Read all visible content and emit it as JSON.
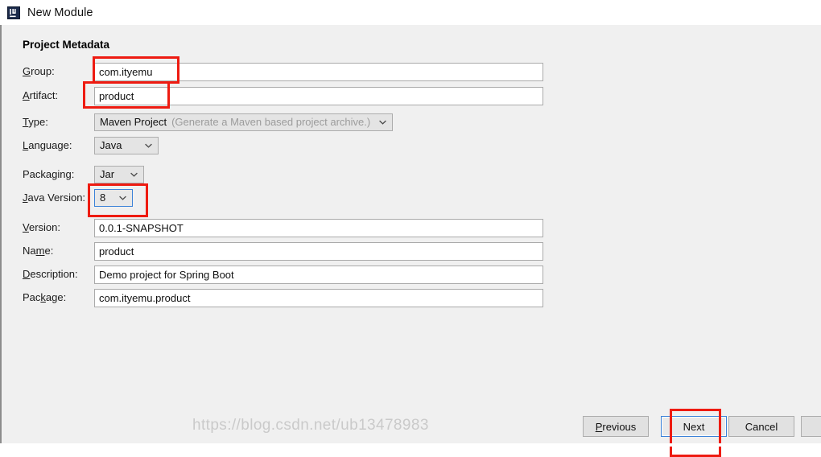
{
  "window": {
    "title": "New Module",
    "app_icon": "intellij-idea-icon",
    "accent_focus_color": "#3c82d8",
    "annotation_color": "#ee1b11",
    "background_color": "#f0f0f0"
  },
  "form": {
    "section_title": "Project Metadata",
    "fields": [
      {
        "id": "group",
        "label_pre": "",
        "label_mnemonic": "G",
        "label_post": "roup:",
        "kind": "text",
        "value": "com.ityemu",
        "annotated": true
      },
      {
        "id": "artifact",
        "label_pre": "",
        "label_mnemonic": "A",
        "label_post": "rtifact:",
        "kind": "text",
        "value": "product",
        "annotated": true
      },
      {
        "id": "type",
        "label_pre": "",
        "label_mnemonic": "T",
        "label_post": "ype:",
        "kind": "combo",
        "value": "Maven Project",
        "hint": "(Generate a Maven based project archive.)",
        "annotated": false
      },
      {
        "id": "language",
        "label_pre": "",
        "label_mnemonic": "L",
        "label_post": "anguage:",
        "kind": "combo",
        "value": "Java",
        "hint": "",
        "annotated": false
      },
      {
        "id": "packaging",
        "label_pre": "Packa",
        "label_mnemonic": "g",
        "label_post": "ing:",
        "kind": "combo",
        "value": "Jar",
        "hint": "",
        "annotated": false
      },
      {
        "id": "java-version",
        "label_pre": "",
        "label_mnemonic": "J",
        "label_post": "ava Version:",
        "kind": "combo",
        "value": "8",
        "hint": "",
        "annotated": true,
        "focused": true
      },
      {
        "id": "version",
        "label_pre": "",
        "label_mnemonic": "V",
        "label_post": "ersion:",
        "kind": "text",
        "value": "0.0.1-SNAPSHOT",
        "annotated": false
      },
      {
        "id": "name",
        "label_pre": "Na",
        "label_mnemonic": "m",
        "label_post": "e:",
        "kind": "text",
        "value": "product",
        "annotated": false
      },
      {
        "id": "description",
        "label_pre": "",
        "label_mnemonic": "D",
        "label_post": "escription:",
        "kind": "text",
        "value": "Demo project for Spring Boot",
        "annotated": false
      },
      {
        "id": "package",
        "label_pre": "Pac",
        "label_mnemonic": "k",
        "label_post": "age:",
        "kind": "text",
        "value": "com.ityemu.product",
        "annotated": false
      }
    ]
  },
  "buttons": {
    "previous": {
      "pre": "",
      "mnemonic": "P",
      "post": "revious"
    },
    "next": {
      "pre": "",
      "mnemonic": "N",
      "post": "ext"
    },
    "cancel": {
      "pre": "",
      "mnemonic": "C",
      "post": "ancel"
    },
    "help": {
      "pre": "",
      "mnemonic": "",
      "post": ""
    }
  },
  "watermark": {
    "text": "https://blog.csdn.net/ub13478983"
  }
}
